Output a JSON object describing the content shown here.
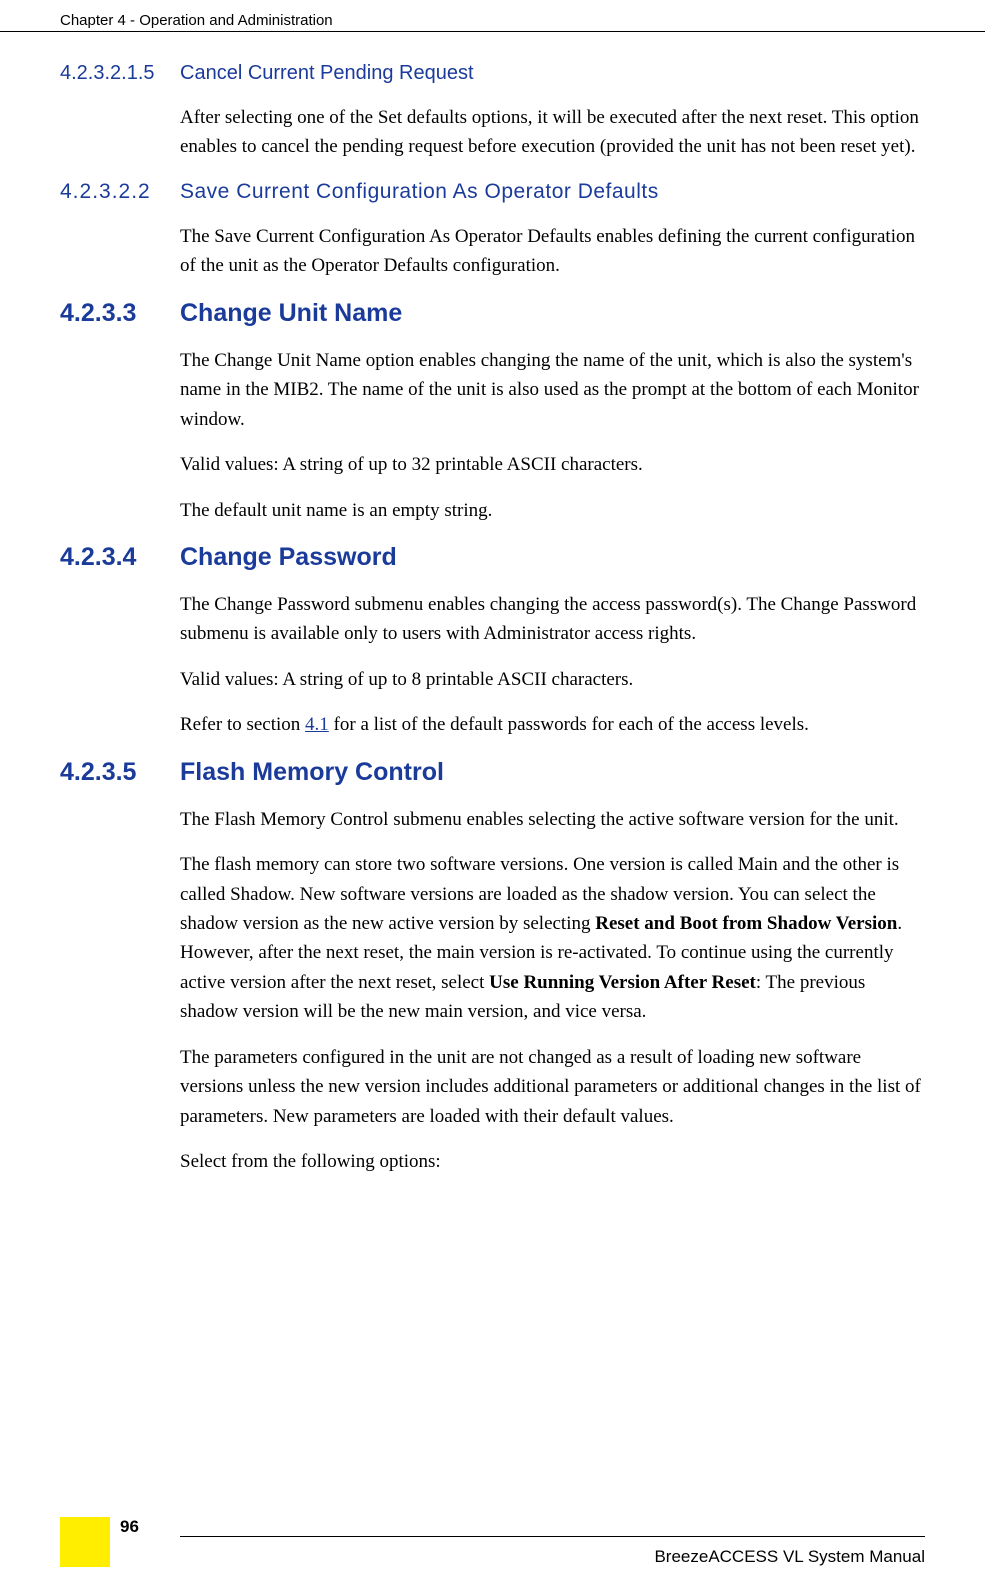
{
  "header": {
    "title": "Chapter 4 - Operation and Administration"
  },
  "sections": [
    {
      "num": "4.2.3.2.1.5",
      "title": "Cancel Current Pending Request",
      "style": "h5",
      "paras": [
        "After selecting one of the Set defaults options, it will be executed after the next reset. This option enables to cancel the pending request before execution (provided the unit has not been reset yet)."
      ]
    },
    {
      "num": "4.2.3.2.2",
      "title": "Save Current Configuration As Operator Defaults",
      "style": "h4-alt",
      "paras": [
        "The Save Current Configuration As Operator Defaults enables defining the current configuration of the unit as the Operator Defaults configuration."
      ]
    },
    {
      "num": "4.2.3.3",
      "title": "Change Unit Name",
      "style": "h3",
      "paras": [
        "The Change Unit Name option enables changing the name of the unit, which is also the system's name in the MIB2. The name of the unit is also used as the prompt at the bottom of each Monitor window.",
        "Valid values: A string of up to 32 printable ASCII characters.",
        "The default unit name is an empty string."
      ]
    },
    {
      "num": "4.2.3.4",
      "title": "Change Password",
      "style": "h3",
      "paras": [
        "The Change Password submenu enables changing the access password(s). The Change Password submenu is available only to users with Administrator access rights.",
        "Valid values: A string of up to 8 printable ASCII characters."
      ],
      "link_para": {
        "before": "Refer to section ",
        "link": "4.1",
        "after": " for a list of the default passwords for each of the access levels."
      }
    },
    {
      "num": "4.2.3.5",
      "title": "Flash Memory Control",
      "style": "h3",
      "paras": [
        "The Flash Memory Control submenu enables selecting the active software version for the unit."
      ],
      "complex_para": {
        "p1": "The flash memory can store two software versions. One version is called Main and the other is called Shadow. New software versions are loaded as the shadow version. You can select the shadow version as the new active version by selecting ",
        "b1": "Reset and Boot from Shadow Version",
        "p2": ". However, after the next reset, the main version is re-activated. To continue using the currently active version after the next reset, select ",
        "b2": "Use Running Version After Reset",
        "p3": ": The previous shadow version will be the new main version, and vice versa."
      },
      "trailing": [
        "The parameters configured in the unit are not changed as a result of loading new software versions unless the new version includes additional parameters or additional changes in the list of parameters. New parameters are loaded with their default values.",
        "Select from the following options:"
      ]
    }
  ],
  "footer": {
    "manual": "BreezeACCESS VL System Manual",
    "page": "96"
  }
}
